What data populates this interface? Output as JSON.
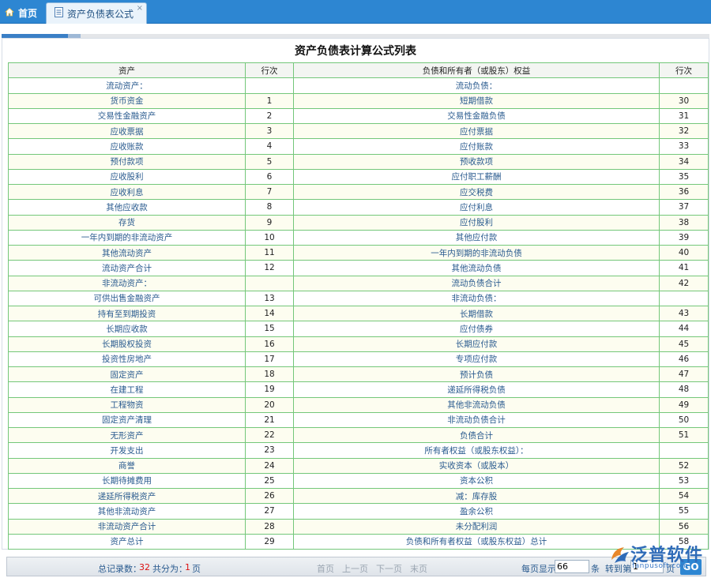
{
  "tabs": {
    "home_label": "首页",
    "active_label": "资产负债表公式",
    "close_glyph": "×"
  },
  "page": {
    "title": "资产负债表计算公式列表"
  },
  "table": {
    "headers": [
      "资产",
      "行次",
      "负债和所有者（或股东）权益",
      "行次"
    ],
    "rows": [
      [
        "流动资产：",
        "",
        "流动负债：",
        ""
      ],
      [
        "货币资金",
        "1",
        "短期借款",
        "30"
      ],
      [
        "交易性金融资产",
        "2",
        "交易性金融负债",
        "31"
      ],
      [
        "应收票据",
        "3",
        "应付票据",
        "32"
      ],
      [
        "应收账款",
        "4",
        "应付账款",
        "33"
      ],
      [
        "预付款项",
        "5",
        "预收款项",
        "34"
      ],
      [
        "应收股利",
        "6",
        "应付职工薪酬",
        "35"
      ],
      [
        "应收利息",
        "7",
        "应交税费",
        "36"
      ],
      [
        "其他应收款",
        "8",
        "应付利息",
        "37"
      ],
      [
        "存货",
        "9",
        "应付股利",
        "38"
      ],
      [
        "一年内到期的非流动资产",
        "10",
        "其他应付款",
        "39"
      ],
      [
        "其他流动资产",
        "11",
        "一年内到期的非流动负债",
        "40"
      ],
      [
        "流动资产合计",
        "12",
        "其他流动负债",
        "41"
      ],
      [
        "非流动资产：",
        "",
        "流动负债合计",
        "42"
      ],
      [
        "可供出售金融资产",
        "13",
        "非流动负债：",
        ""
      ],
      [
        "持有至到期投资",
        "14",
        "长期借款",
        "43"
      ],
      [
        "长期应收款",
        "15",
        "应付债券",
        "44"
      ],
      [
        "长期股权投资",
        "16",
        "长期应付款",
        "45"
      ],
      [
        "投资性房地产",
        "17",
        "专项应付款",
        "46"
      ],
      [
        "固定资产",
        "18",
        "预计负债",
        "47"
      ],
      [
        "在建工程",
        "19",
        "递延所得税负债",
        "48"
      ],
      [
        "工程物资",
        "20",
        "其他非流动负债",
        "49"
      ],
      [
        "固定资产清理",
        "21",
        "非流动负债合计",
        "50"
      ],
      [
        "无形资产",
        "22",
        "负债合计",
        "51"
      ],
      [
        "开发支出",
        "23",
        "所有者权益（或股东权益）：",
        ""
      ],
      [
        "商誉",
        "24",
        "实收资本（或股本）",
        "52"
      ],
      [
        "长期待摊费用",
        "25",
        "资本公积",
        "53"
      ],
      [
        "递延所得税资产",
        "26",
        "减：库存股",
        "54"
      ],
      [
        "其他非流动资产",
        "27",
        "盈余公积",
        "55"
      ],
      [
        "非流动资产合计",
        "28",
        "未分配利润",
        "56"
      ],
      [
        "资产总计",
        "29",
        "负债和所有者权益（或股东权益）总计",
        "58"
      ]
    ]
  },
  "pager": {
    "total_label": "总记录数：",
    "total_value": "32",
    "pages_label": "共分为：",
    "pages_value": "1",
    "pages_unit": "页",
    "first": "首页",
    "prev": "上一页",
    "next": "下一页",
    "last": "末页",
    "per_page_label": "每页显示",
    "per_page_value": "66",
    "per_page_unit": "条",
    "goto_label": "转到第",
    "goto_value": "1",
    "goto_unit": "页",
    "go_label": "GO"
  },
  "logo": {
    "cn": "泛普软件",
    "en": "fanpusoft.com"
  },
  "colors": {
    "tabbar": "#2d86d2",
    "grid_border": "#74c77a",
    "row_tint": "#fdfdf0",
    "link_text": "#2a5b8f"
  }
}
